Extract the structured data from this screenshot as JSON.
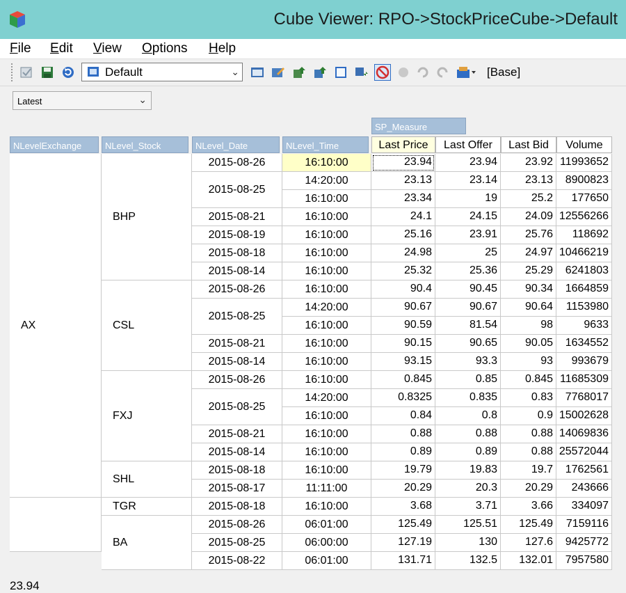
{
  "window": {
    "title": "Cube Viewer: RPO->StockPriceCube->Default"
  },
  "menu": [
    {
      "key": "F",
      "rest": "ile"
    },
    {
      "key": "E",
      "rest": "dit"
    },
    {
      "key": "V",
      "rest": "iew"
    },
    {
      "key": "O",
      "rest": "ptions"
    },
    {
      "key": "H",
      "rest": "elp"
    }
  ],
  "toolbar": {
    "view_selected": "Default",
    "base_label": "[Base]"
  },
  "filter": {
    "selected": "Latest"
  },
  "grid": {
    "column_dimension": "SP_Measure",
    "row_dimensions": [
      "NLevelExchange",
      "NLevel_Stock",
      "NLevel_Date",
      "NLevel_Time"
    ],
    "measures": [
      "Last Price",
      "Last Offer",
      "Last Bid",
      "Volume"
    ],
    "exchanges": [
      {
        "name": "AX",
        "rows": 19
      },
      {
        "name": "",
        "rows": 3
      }
    ],
    "stocks": [
      {
        "name": "BHP",
        "rows": 7
      },
      {
        "name": "CSL",
        "rows": 5
      },
      {
        "name": "FXJ",
        "rows": 5
      },
      {
        "name": "SHL",
        "rows": 2
      },
      {
        "name": "TGR",
        "rows": 1
      },
      {
        "name": "BA",
        "rows": 3
      }
    ],
    "dates": [
      {
        "value": "2015-08-26",
        "rows": 1
      },
      {
        "value": "2015-08-25",
        "rows": 2
      },
      {
        "value": "2015-08-21",
        "rows": 1
      },
      {
        "value": "2015-08-19",
        "rows": 1
      },
      {
        "value": "2015-08-18",
        "rows": 1
      },
      {
        "value": "2015-08-14",
        "rows": 1
      },
      {
        "value": "2015-08-26",
        "rows": 1
      },
      {
        "value": "2015-08-25",
        "rows": 2
      },
      {
        "value": "2015-08-21",
        "rows": 1
      },
      {
        "value": "2015-08-14",
        "rows": 1
      },
      {
        "value": "2015-08-26",
        "rows": 1
      },
      {
        "value": "2015-08-25",
        "rows": 2
      },
      {
        "value": "2015-08-21",
        "rows": 1
      },
      {
        "value": "2015-08-14",
        "rows": 1
      },
      {
        "value": "2015-08-18",
        "rows": 1
      },
      {
        "value": "2015-08-17",
        "rows": 1
      },
      {
        "value": "2015-08-18",
        "rows": 1
      },
      {
        "value": "2015-08-26",
        "rows": 1
      },
      {
        "value": "2015-08-25",
        "rows": 1
      },
      {
        "value": "2015-08-22",
        "rows": 1
      }
    ],
    "rows": [
      {
        "time": "16:10:00",
        "values": [
          "23.94",
          "23.94",
          "23.92",
          "11993652"
        ]
      },
      {
        "time": "14:20:00",
        "values": [
          "23.13",
          "23.14",
          "23.13",
          "8900823"
        ]
      },
      {
        "time": "16:10:00",
        "values": [
          "23.34",
          "19",
          "25.2",
          "177650"
        ]
      },
      {
        "time": "16:10:00",
        "values": [
          "24.1",
          "24.15",
          "24.09",
          "12556266"
        ]
      },
      {
        "time": "16:10:00",
        "values": [
          "25.16",
          "23.91",
          "25.76",
          "118692"
        ]
      },
      {
        "time": "16:10:00",
        "values": [
          "24.98",
          "25",
          "24.97",
          "10466219"
        ]
      },
      {
        "time": "16:10:00",
        "values": [
          "25.32",
          "25.36",
          "25.29",
          "6241803"
        ]
      },
      {
        "time": "16:10:00",
        "values": [
          "90.4",
          "90.45",
          "90.34",
          "1664859"
        ]
      },
      {
        "time": "14:20:00",
        "values": [
          "90.67",
          "90.67",
          "90.64",
          "1153980"
        ]
      },
      {
        "time": "16:10:00",
        "values": [
          "90.59",
          "81.54",
          "98",
          "9633"
        ]
      },
      {
        "time": "16:10:00",
        "values": [
          "90.15",
          "90.65",
          "90.05",
          "1634552"
        ]
      },
      {
        "time": "16:10:00",
        "values": [
          "93.15",
          "93.3",
          "93",
          "993679"
        ]
      },
      {
        "time": "16:10:00",
        "values": [
          "0.845",
          "0.85",
          "0.845",
          "11685309"
        ]
      },
      {
        "time": "14:20:00",
        "values": [
          "0.8325",
          "0.835",
          "0.83",
          "7768017"
        ]
      },
      {
        "time": "16:10:00",
        "values": [
          "0.84",
          "0.8",
          "0.9",
          "15002628"
        ]
      },
      {
        "time": "16:10:00",
        "values": [
          "0.88",
          "0.88",
          "0.88",
          "14069836"
        ]
      },
      {
        "time": "16:10:00",
        "values": [
          "0.89",
          "0.89",
          "0.88",
          "25572044"
        ]
      },
      {
        "time": "16:10:00",
        "values": [
          "19.79",
          "19.83",
          "19.7",
          "1762561"
        ]
      },
      {
        "time": "11:11:00",
        "values": [
          "20.29",
          "20.3",
          "20.29",
          "243666"
        ]
      },
      {
        "time": "16:10:00",
        "values": [
          "3.68",
          "3.71",
          "3.66",
          "334097"
        ]
      },
      {
        "time": "06:01:00",
        "values": [
          "125.49",
          "125.51",
          "125.49",
          "7159116"
        ]
      },
      {
        "time": "06:00:00",
        "values": [
          "127.19",
          "130",
          "127.6",
          "9425772"
        ]
      },
      {
        "time": "06:01:00",
        "values": [
          "131.71",
          "132.5",
          "132.01",
          "7957580"
        ]
      }
    ]
  },
  "status": {
    "text": "23.94"
  },
  "colors": {
    "title_bar": "#7fd0d0",
    "dimension_header": "#a6bfd9",
    "selected_time": "#ffffc8"
  }
}
